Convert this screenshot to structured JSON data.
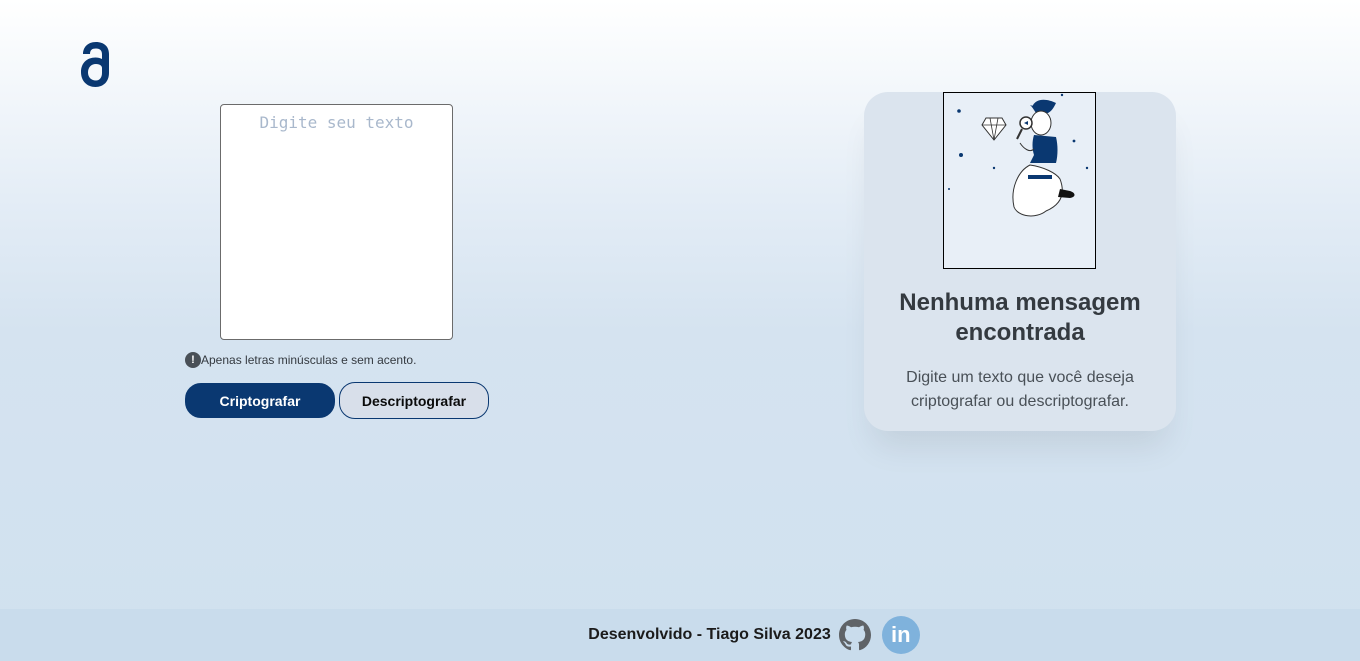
{
  "logo": {
    "icon": "alura-logo-icon",
    "color": "#0a3871"
  },
  "input": {
    "placeholder": "Digite seu texto",
    "value": ""
  },
  "hint": {
    "icon": "exclamation-icon",
    "text": "Apenas letras minúsculas e sem acento."
  },
  "buttons": {
    "encrypt_label": "Criptografar",
    "decrypt_label": "Descriptografar"
  },
  "output": {
    "illustration": "person-with-magnifying-glass-illustration",
    "title": "Nenhuma mensagem encontrada",
    "text": "Digite um texto que você deseja criptografar ou descriptografar."
  },
  "footer": {
    "text": "Desenvolvido - Tiago Silva 2023",
    "github_icon": "github-icon",
    "linkedin_icon": "linkedin-icon",
    "linkedin_label": "in"
  },
  "colors": {
    "primary": "#0a3871",
    "footer_bg": "#c9dcec",
    "linkedin": "#7fb2dc"
  }
}
